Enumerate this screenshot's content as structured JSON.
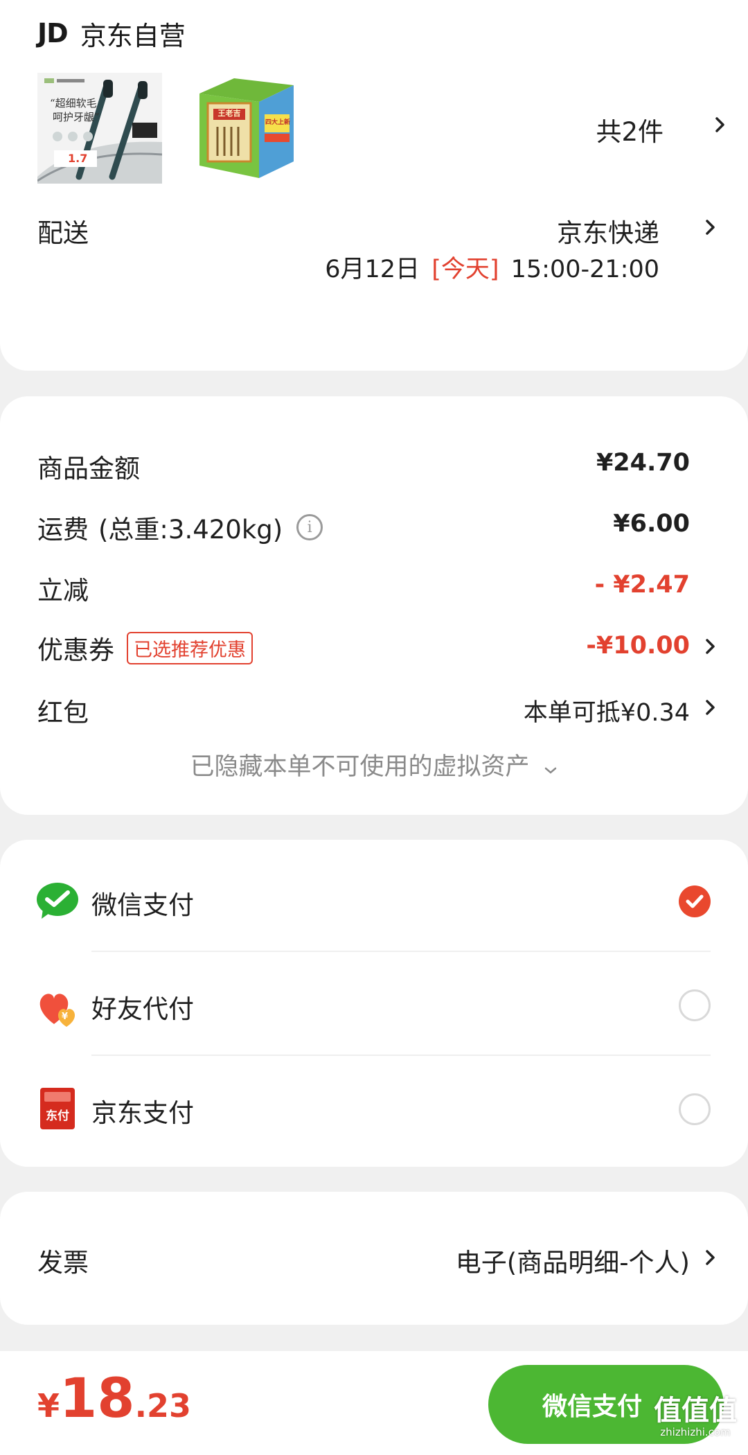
{
  "shop": {
    "logo": "JD",
    "name": "京东自营"
  },
  "products": {
    "toothbrush": {
      "caption_line1": "“超细软毛",
      "caption_line2": "呵护牙龈”",
      "price": "1.7"
    },
    "tea_box": {
      "brand_text": "王老吉",
      "side_text": "四大上新"
    },
    "count_label": "共2件"
  },
  "delivery": {
    "label": "配送",
    "carrier": "京东快递",
    "date": "6月12日",
    "today_tag": "[今天]",
    "time_window": "15:00-21:00"
  },
  "summary": {
    "goods_amount": {
      "label": "商品金额",
      "value": "¥24.70"
    },
    "shipping": {
      "label": "运费",
      "weight": "(总重:3.420kg)",
      "value": "¥6.00"
    },
    "discount": {
      "label": "立减",
      "value": "- ¥2.47"
    },
    "coupon": {
      "label": "优惠券",
      "tag": "已选推荐优惠",
      "value": "-¥10.00"
    },
    "red_packet": {
      "label": "红包",
      "value": "本单可抵¥0.34"
    },
    "hidden_assets": "已隐藏本单不可使用的虚拟资产"
  },
  "payment": {
    "options": [
      {
        "label": "微信支付",
        "selected": true
      },
      {
        "label": "好友代付",
        "selected": false
      },
      {
        "label": "京东支付",
        "selected": false
      }
    ],
    "jd_icon_text": "东付",
    "friend_icon_text": "¥"
  },
  "invoice": {
    "label": "发票",
    "value": "电子(商品明细-个人)"
  },
  "footer": {
    "currency": "¥",
    "total_int": "18",
    "total_dec": ".23",
    "pay_button": "微信支付",
    "watermark_main": "值值值",
    "watermark_url": "zhizhizhi.com"
  },
  "colors": {
    "accent_red": "#e2412f",
    "wechat_green": "#4cb733",
    "background": "#f0f0f0"
  }
}
